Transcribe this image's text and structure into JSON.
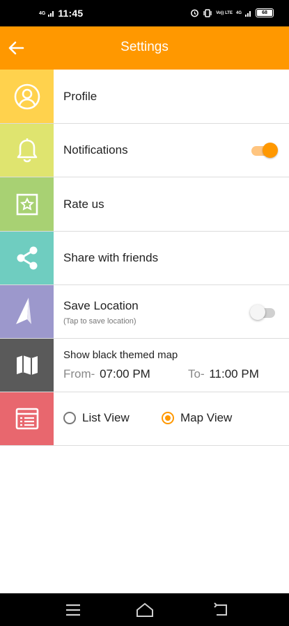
{
  "status_bar": {
    "network_left": "4G",
    "time": "11:45",
    "volte_label": "Vo)) LTE",
    "network_right": "4G",
    "battery": "68"
  },
  "app_bar": {
    "title": "Settings"
  },
  "colors": {
    "accent": "#ff9800",
    "profile": "#ffd24d",
    "notifications": "#dfe46f",
    "rate": "#a8d173",
    "share": "#6fcdc0",
    "location": "#9c98cc",
    "map": "#5a5a5a",
    "view": "#e8676e"
  },
  "settings": {
    "profile": {
      "label": "Profile",
      "icon": "person-circle-icon"
    },
    "notifications": {
      "label": "Notifications",
      "icon": "bell-icon",
      "enabled": true
    },
    "rate": {
      "label": "Rate us",
      "icon": "star-box-icon"
    },
    "share": {
      "label": "Share with friends",
      "icon": "share-icon"
    },
    "save_location": {
      "label": "Save Location",
      "subtitle": "(Tap to save location)",
      "icon": "navigation-arrow-icon",
      "enabled": false
    },
    "black_map": {
      "label": "Show black themed map",
      "from_label": "From-",
      "from_time": "07:00 PM",
      "to_label": "To-",
      "to_time": "11:00 PM",
      "icon": "map-icon"
    },
    "view_mode": {
      "icon": "list-view-icon",
      "options": [
        "List View",
        "Map View"
      ],
      "selected": "Map View"
    }
  },
  "nav_bar": {
    "icons": [
      "menu-icon",
      "home-icon",
      "back-icon"
    ]
  }
}
